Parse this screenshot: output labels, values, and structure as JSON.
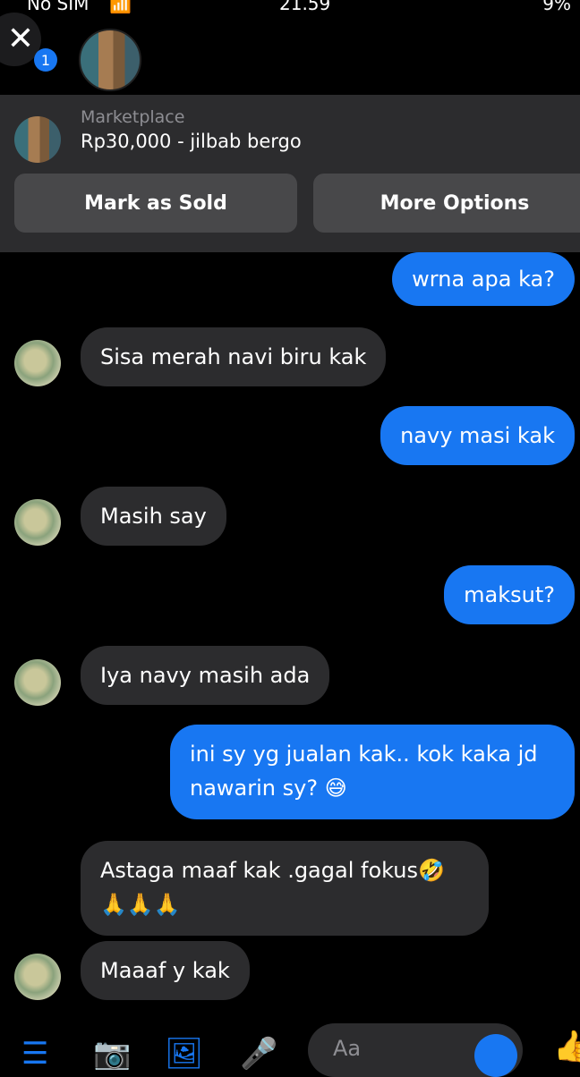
{
  "status_bar": {
    "carrier": "No SIM",
    "time": "21.59",
    "battery": "9%"
  },
  "header": {
    "unread_count": "1",
    "close_icon": "close-icon"
  },
  "listing": {
    "source": "Marketplace",
    "title": "Rp30,000 - jilbab bergo",
    "mark_sold_label": "Mark as Sold",
    "more_options_label": "More Options"
  },
  "messages": [
    {
      "from": "me",
      "text": "wrna apa ka?"
    },
    {
      "from": "them",
      "text": "Sisa merah navi biru kak"
    },
    {
      "from": "me",
      "text": "navy masi kak"
    },
    {
      "from": "them",
      "text": "Masih say"
    },
    {
      "from": "me",
      "text": "maksut?"
    },
    {
      "from": "them",
      "text": "Iya navy masih ada"
    },
    {
      "from": "me",
      "line1": "ini sy yg jualan kak.. kok kaka jd",
      "line2": "nawarin sy? 😅"
    },
    {
      "from": "them",
      "line1": "Astaga maaf kak .gagal fokus🤣",
      "line2": "🙏🙏🙏"
    },
    {
      "from": "them",
      "text": "Maaaf y kak"
    }
  ],
  "composer": {
    "placeholder": "Aa"
  },
  "icons": {
    "menu": "menu-icon",
    "camera": "camera-icon",
    "gallery": "image-icon",
    "mic": "microphone-icon",
    "emoji": "emoji-icon",
    "like": "thumbs-up-icon"
  }
}
